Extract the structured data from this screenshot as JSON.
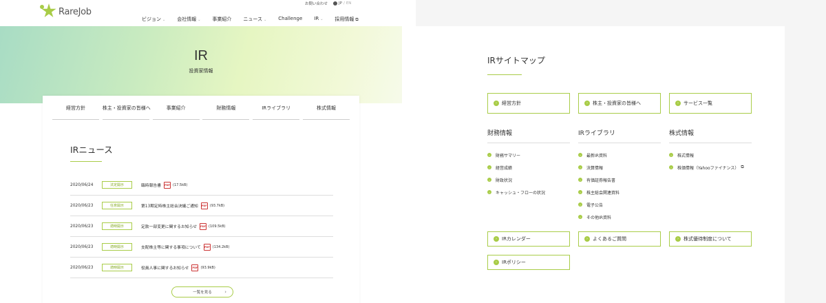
{
  "header": {
    "logo_text": "RareJob",
    "contact": "お問い合わせ",
    "lang_jp": "JP",
    "lang_sep": "/",
    "lang_en": "EN",
    "nav": [
      {
        "label": "ビジョン",
        "dropdown": true
      },
      {
        "label": "会社情報",
        "dropdown": true
      },
      {
        "label": "事業紹介",
        "dropdown": false
      },
      {
        "label": "ニュース",
        "dropdown": true
      },
      {
        "label": "Challenge",
        "dropdown": false
      },
      {
        "label": "IR",
        "dropdown": true
      },
      {
        "label": "採用情報",
        "external": true
      }
    ]
  },
  "hero": {
    "title": "IR",
    "subtitle": "投資家情報"
  },
  "tabs": [
    "経営方針",
    "株主・投資家の皆様へ",
    "事業紹介",
    "財務情報",
    "IRライブラリ",
    "株式情報"
  ],
  "news": {
    "title": "IRニュース",
    "items": [
      {
        "date": "2020/06/24",
        "badge": "法定開示",
        "title": "臨時報告書",
        "size": "(17.5kB)"
      },
      {
        "date": "2020/06/23",
        "badge": "任意開示",
        "title": "第13期定時株主総会決議ご通知",
        "size": "(93.7kB)"
      },
      {
        "date": "2020/06/23",
        "badge": "適時開示",
        "title": "定款一部変更に関するお知らせ",
        "size": "(109.5kB)"
      },
      {
        "date": "2020/06/23",
        "badge": "適時開示",
        "title": "支配株主等に関する事項について",
        "size": "(134.2kB)"
      },
      {
        "date": "2020/06/23",
        "badge": "適時開示",
        "title": "役員人事に関するお知らせ",
        "size": "(93.9kB)"
      }
    ],
    "more_label": "一覧を見る"
  },
  "sitemap": {
    "title": "IRサイトマップ",
    "top_boxes": [
      "経営方針",
      "株主・投資家の皆様へ",
      "サービス一覧"
    ],
    "columns": [
      {
        "head": "財務情報",
        "items": [
          "財務サマリー",
          "経営成績",
          "財政状況",
          "キャッシュ・フローの状況"
        ]
      },
      {
        "head": "IRライブラリ",
        "items": [
          "最新IR資料",
          "決算情報",
          "有価証券報告書",
          "株主総会関連資料",
          "電子公告",
          "その他IR資料"
        ]
      },
      {
        "head": "株式情報",
        "items": [
          "株式情報",
          "株価情報（Yahooファイナンス）"
        ]
      }
    ],
    "bottom_boxes": [
      "IRカレンダー",
      "よくあるご質問",
      "株式優待制度について",
      "IRポリシー"
    ]
  },
  "colors": {
    "accent": "#a8cc47",
    "pdf": "#cc3333"
  }
}
